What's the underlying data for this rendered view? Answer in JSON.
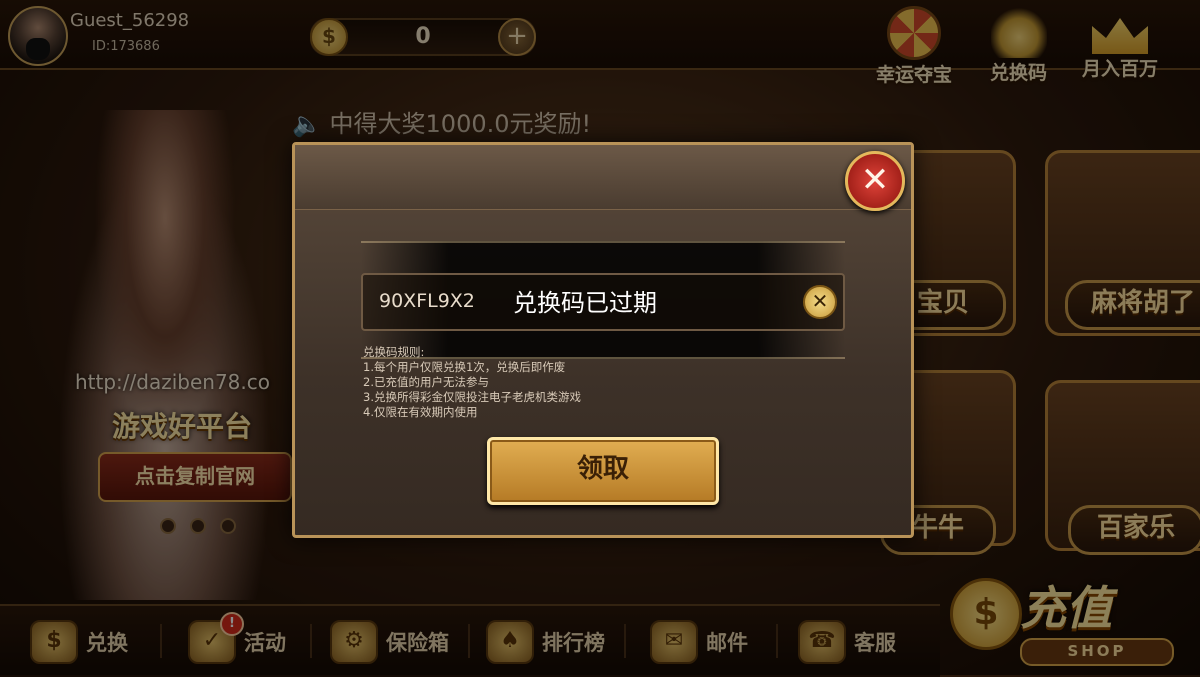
{
  "header": {
    "username": "Guest_56298",
    "user_id": "ID:173686",
    "coin_symbol": "$",
    "balance": "0",
    "add_symbol": "+",
    "features": [
      {
        "label": "幸运夺宝",
        "icon": "fortune-wheel-icon"
      },
      {
        "label": "兑换码",
        "icon": "coin-stack-icon"
      },
      {
        "label": "月入百万",
        "icon": "crown-icon"
      }
    ]
  },
  "marquee": {
    "icon": "🔈",
    "text": "中得大奖1000.0元奖励!"
  },
  "promo": {
    "website": "http://daziben78.co",
    "title": "游戏好平台",
    "copy_button": "点击复制官网"
  },
  "games": [
    {
      "label": "宝贝"
    },
    {
      "label": "麻将胡了"
    },
    {
      "label": "牛牛"
    },
    {
      "label": "百家乐"
    }
  ],
  "recharge": {
    "coin": "$",
    "title": "充值",
    "shop": "SHOP"
  },
  "bottom_nav": [
    {
      "label": "兑换",
      "icon": "exchange-icon",
      "glyph": "$"
    },
    {
      "label": "活动",
      "icon": "activity-icon",
      "glyph": "✓",
      "badge": "!"
    },
    {
      "label": "保险箱",
      "icon": "safe-icon",
      "glyph": "⚙"
    },
    {
      "label": "排行榜",
      "icon": "trophy-icon",
      "glyph": "♠"
    },
    {
      "label": "邮件",
      "icon": "mail-icon",
      "glyph": "✉"
    },
    {
      "label": "客服",
      "icon": "support-icon",
      "glyph": "☎"
    }
  ],
  "modal": {
    "close_glyph": "✕",
    "code_value": "90XFL9X2",
    "toast": "兑换码已过期",
    "clear_glyph": "✕",
    "rules_title": "兑换码规则:",
    "rules": [
      "1.每个用户仅限兑换1次，兑换后即作废",
      "2.已充值的用户无法参与",
      "3.兑换所得彩金仅限投注电子老虎机类游戏",
      "4.仅限在有效期内使用"
    ],
    "claim_button": "领取"
  },
  "colors": {
    "accent_gold": "#e1ae52",
    "close_red": "#c8261c",
    "modal_bg": "#3d3128"
  }
}
